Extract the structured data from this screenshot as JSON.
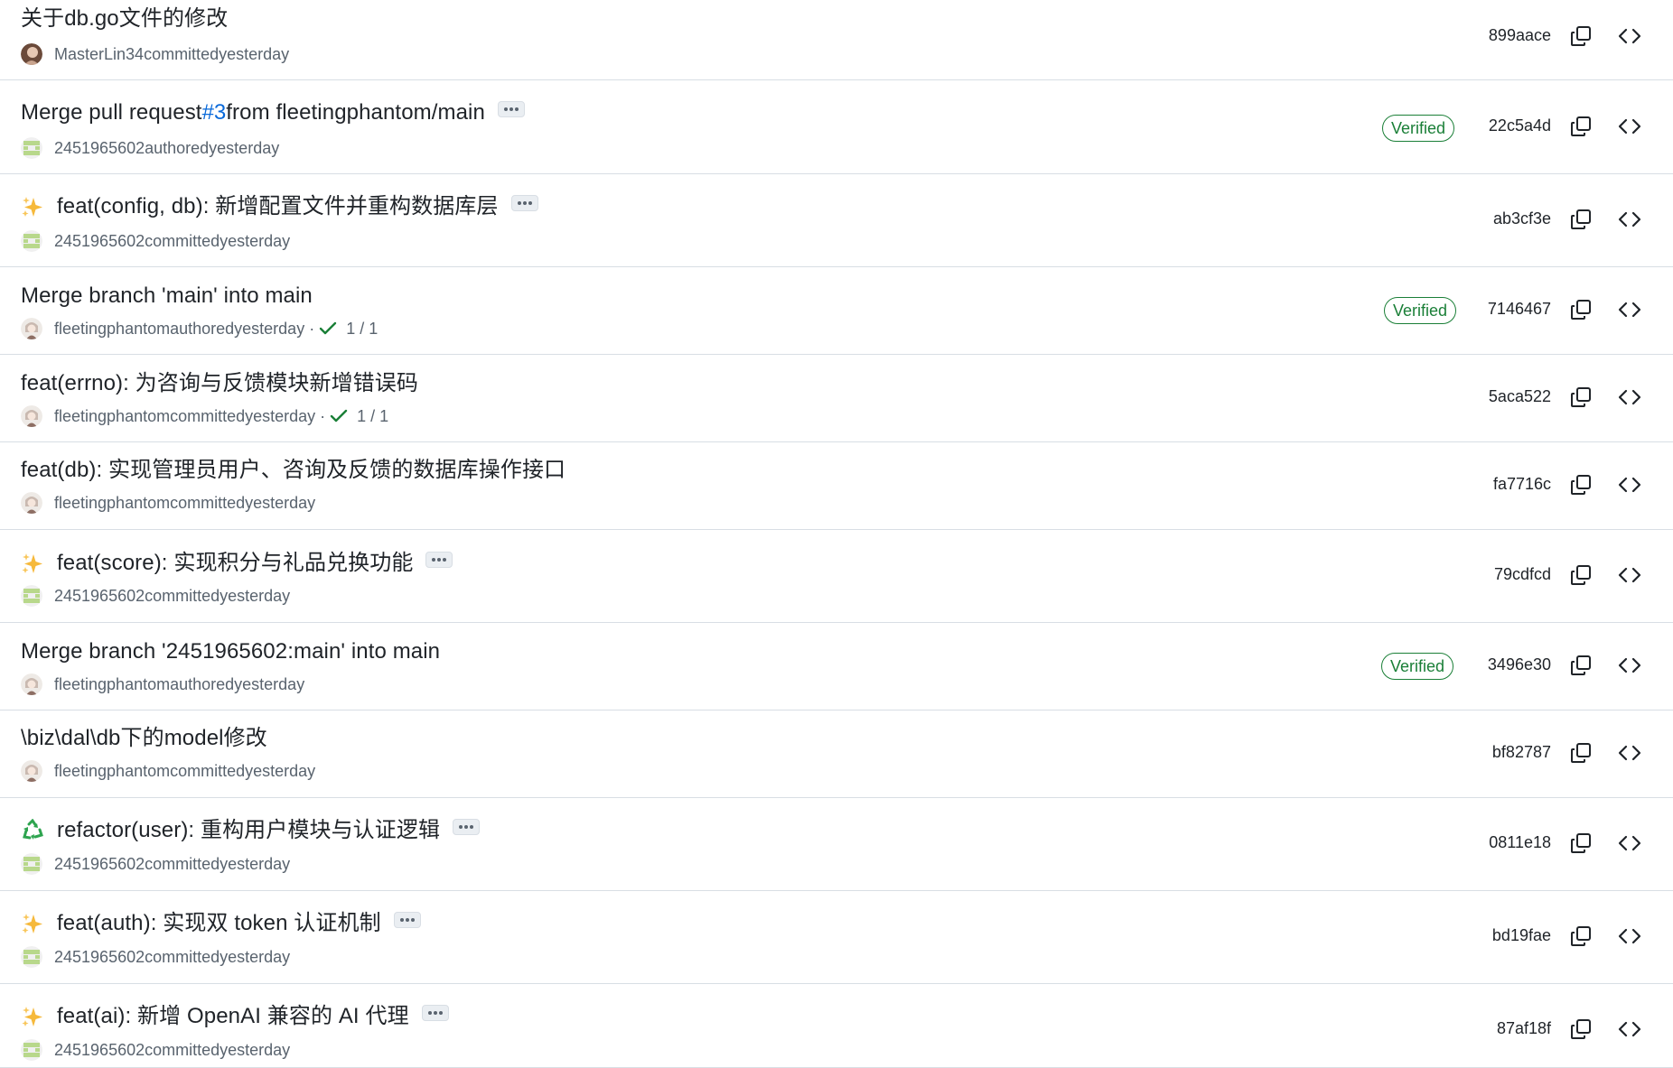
{
  "verified_label": "Verified",
  "commits": [
    {
      "title": "关于db.go文件的修改",
      "author": "MasterLin34",
      "action": "committed",
      "time": "yesterday",
      "sha": "899aace",
      "avatar": "masterlin",
      "emoji": null,
      "has_ellipsis": false,
      "verified": false,
      "checks": null
    },
    {
      "title_prefix": "Merge pull request ",
      "title_link": "#3",
      "title_suffix": " from fleetingphantom/main",
      "author": "2451965602",
      "action": "authored",
      "time": "yesterday",
      "sha": "22c5a4d",
      "avatar": "green-identicon",
      "emoji": null,
      "has_ellipsis": true,
      "verified": true,
      "checks": null
    },
    {
      "title": "feat(config, db): 新增配置文件并重构数据库层",
      "author": "2451965602",
      "action": "committed",
      "time": "yesterday",
      "sha": "ab3cf3e",
      "avatar": "green-identicon",
      "emoji": "sparkles",
      "has_ellipsis": true,
      "verified": false,
      "checks": null
    },
    {
      "title": "Merge branch 'main' into main",
      "author": "fleetingphantom",
      "action": "authored",
      "time": "yesterday",
      "sha": "7146467",
      "avatar": "anime-avatar",
      "emoji": null,
      "has_ellipsis": false,
      "verified": true,
      "checks": "1 / 1"
    },
    {
      "title": "feat(errno): 为咨询与反馈模块新增错误码",
      "author": "fleetingphantom",
      "action": "committed",
      "time": "yesterday",
      "sha": "5aca522",
      "avatar": "anime-avatar",
      "emoji": null,
      "has_ellipsis": false,
      "verified": false,
      "checks": "1 / 1"
    },
    {
      "title": "feat(db): 实现管理员用户、咨询及反馈的数据库操作接口",
      "author": "fleetingphantom",
      "action": "committed",
      "time": "yesterday",
      "sha": "fa7716c",
      "avatar": "anime-avatar",
      "emoji": null,
      "has_ellipsis": false,
      "verified": false,
      "checks": null
    },
    {
      "title": "feat(score): 实现积分与礼品兑换功能",
      "author": "2451965602",
      "action": "committed",
      "time": "yesterday",
      "sha": "79cdfcd",
      "avatar": "green-identicon",
      "emoji": "sparkles",
      "has_ellipsis": true,
      "verified": false,
      "checks": null
    },
    {
      "title": "Merge branch '2451965602:main' into main",
      "author": "fleetingphantom",
      "action": "authored",
      "time": "yesterday",
      "sha": "3496e30",
      "avatar": "anime-avatar",
      "emoji": null,
      "has_ellipsis": false,
      "verified": true,
      "checks": null
    },
    {
      "title": "\\biz\\dal\\db下的model修改",
      "author": "fleetingphantom",
      "action": "committed",
      "time": "yesterday",
      "sha": "bf82787",
      "avatar": "anime-avatar",
      "emoji": null,
      "has_ellipsis": false,
      "verified": false,
      "checks": null
    },
    {
      "title": "refactor(user): 重构用户模块与认证逻辑",
      "author": "2451965602",
      "action": "committed",
      "time": "yesterday",
      "sha": "0811e18",
      "avatar": "green-identicon",
      "emoji": "recycle",
      "has_ellipsis": true,
      "verified": false,
      "checks": null
    },
    {
      "title": "feat(auth): 实现双 token 认证机制",
      "author": "2451965602",
      "action": "committed",
      "time": "yesterday",
      "sha": "bd19fae",
      "avatar": "green-identicon",
      "emoji": "sparkles",
      "has_ellipsis": true,
      "verified": false,
      "checks": null
    },
    {
      "title": "feat(ai): 新增 OpenAI 兼容的 AI 代理",
      "author": "2451965602",
      "action": "committed",
      "time": "yesterday",
      "sha": "87af18f",
      "avatar": "green-identicon",
      "emoji": "sparkles",
      "has_ellipsis": true,
      "verified": false,
      "checks": null
    }
  ],
  "colors": {
    "text": "#1f2328",
    "muted": "#59636e",
    "link": "#0969da",
    "verified": "#1a7f37",
    "border": "#d8dee4",
    "check": "#1a7f37"
  }
}
